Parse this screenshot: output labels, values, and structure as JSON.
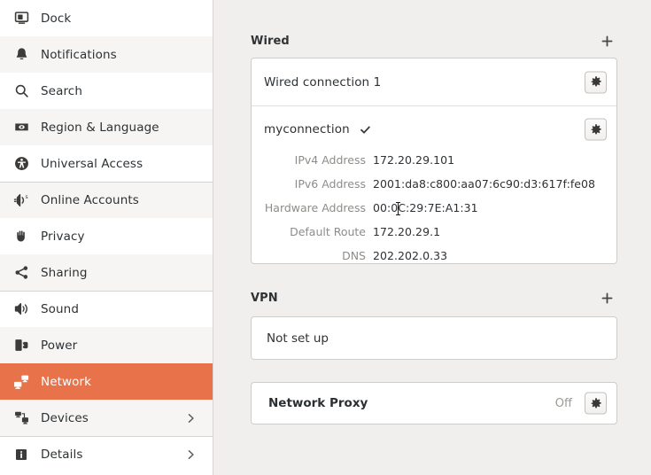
{
  "sidebar": {
    "items": [
      {
        "label": "Dock",
        "icon": "dock-icon",
        "chevron": false
      },
      {
        "label": "Notifications",
        "icon": "bell-icon",
        "chevron": false
      },
      {
        "label": "Search",
        "icon": "search-icon",
        "chevron": false
      },
      {
        "label": "Region & Language",
        "icon": "flag-icon",
        "chevron": false
      },
      {
        "label": "Universal Access",
        "icon": "accessibility-icon",
        "chevron": false
      },
      {
        "label": "Online Accounts",
        "icon": "online-accounts-icon",
        "chevron": false
      },
      {
        "label": "Privacy",
        "icon": "hand-icon",
        "chevron": false
      },
      {
        "label": "Sharing",
        "icon": "share-icon",
        "chevron": false
      },
      {
        "label": "Sound",
        "icon": "speaker-icon",
        "chevron": false
      },
      {
        "label": "Power",
        "icon": "power-plug-icon",
        "chevron": false
      },
      {
        "label": "Network",
        "icon": "network-icon",
        "chevron": false,
        "selected": true
      },
      {
        "label": "Devices",
        "icon": "devices-icon",
        "chevron": true
      },
      {
        "label": "Details",
        "icon": "info-icon",
        "chevron": true
      }
    ],
    "selected_color": "#e8724a"
  },
  "main": {
    "wired": {
      "title": "Wired",
      "add_label": "+",
      "connections": [
        {
          "name": "Wired connection 1",
          "active": false,
          "settings_label": "gear"
        },
        {
          "name": "myconnection",
          "active": true,
          "settings_label": "gear"
        }
      ],
      "details": [
        {
          "label": "IPv4 Address",
          "value": "172.20.29.101"
        },
        {
          "label": "IPv6 Address",
          "value": "2001:da8:c800:aa07:6c90:d3:617f:fe08"
        },
        {
          "label": "Hardware Address",
          "value": "00:0C:29:7E:A1:31"
        },
        {
          "label": "Default Route",
          "value": "172.20.29.1"
        },
        {
          "label": "DNS",
          "value": "202.202.0.33"
        }
      ]
    },
    "vpn": {
      "title": "VPN",
      "add_label": "+",
      "status": "Not set up"
    },
    "proxy": {
      "title": "Network Proxy",
      "state": "Off"
    }
  }
}
